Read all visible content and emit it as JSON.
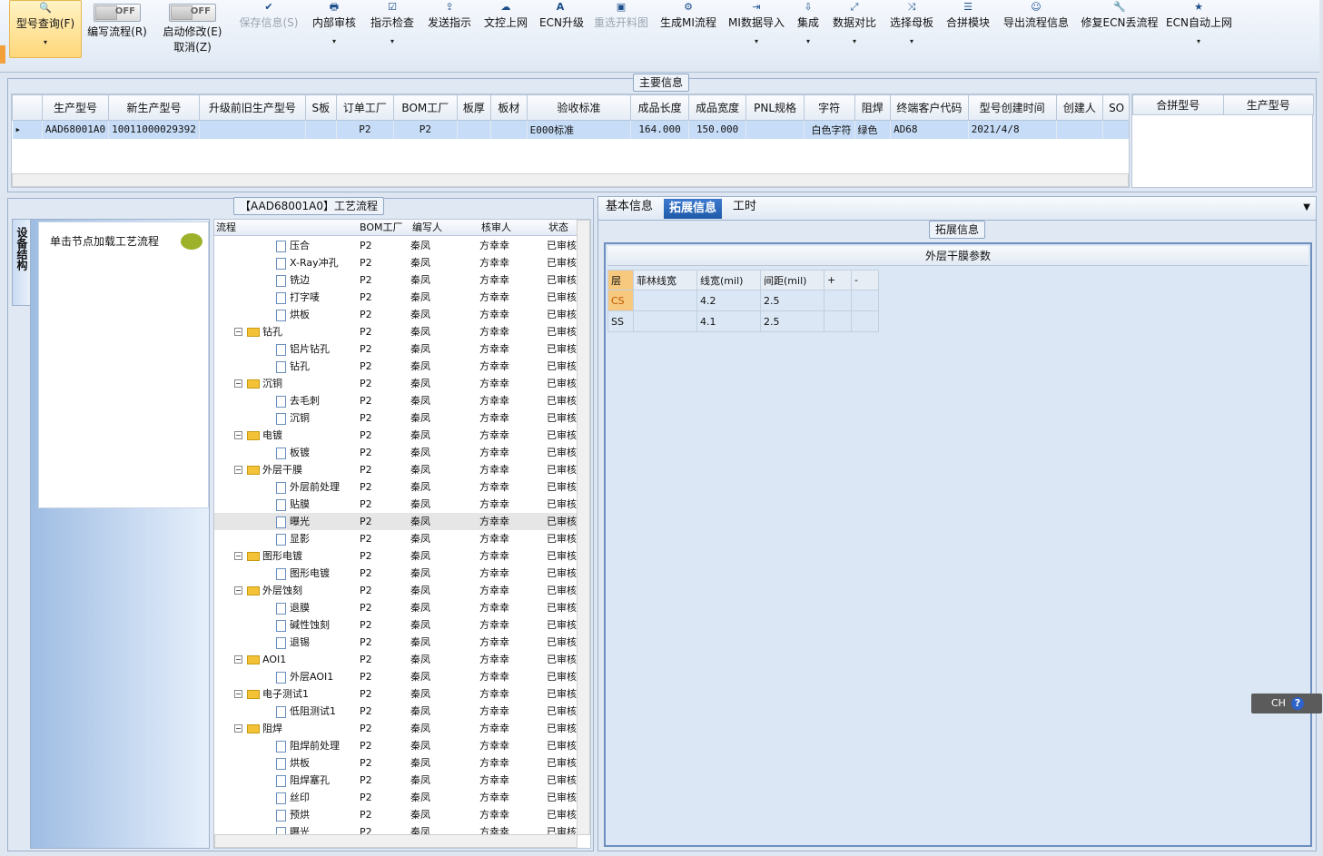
{
  "toolbar": {
    "items": [
      {
        "label": "型号查询(F)",
        "icon": "search-icon",
        "state": "active"
      },
      {
        "label": "编写流程(R)",
        "toggle": "OFF"
      },
      {
        "label": "启动修改(E)",
        "label2": "取消(Z)",
        "toggle": "OFF"
      },
      {
        "label": "保存信息(S)",
        "icon": "check-icon",
        "state": "disabled"
      },
      {
        "label": "内部审核",
        "icon": "printer-icon"
      },
      {
        "label": "指示检查",
        "icon": "checkbox-icon"
      },
      {
        "label": "发送指示",
        "icon": "upload-icon"
      },
      {
        "label": "文控上网",
        "icon": "cloud-upload-icon"
      },
      {
        "label": "ECN升级",
        "icon": "letter-a-icon"
      },
      {
        "label": "重选开料图",
        "icon": "image-icon",
        "state": "disabled"
      },
      {
        "label": "生成MI流程",
        "icon": "gears-icon"
      },
      {
        "label": "MI数据导入",
        "icon": "import-icon"
      },
      {
        "label": "集成",
        "icon": "download-icon"
      },
      {
        "label": "数据对比",
        "icon": "compare-icon"
      },
      {
        "label": "选择母板",
        "icon": "shuffle-icon"
      },
      {
        "label": "合拼模块",
        "icon": "list-icon"
      },
      {
        "label": "导出流程信息",
        "icon": "smiley-icon"
      },
      {
        "label": "修复ECN丢流程",
        "icon": "wrench-icon"
      },
      {
        "label": "ECN自动上网",
        "icon": "star-icon"
      }
    ]
  },
  "main_info": {
    "caption": "主要信息",
    "columns": [
      "生产型号",
      "新生产型号",
      "升级前旧生产型号",
      "S板",
      "订单工厂",
      "BOM工厂",
      "板厚",
      "板材",
      "验收标准",
      "成品长度",
      "成品宽度",
      "PNL规格",
      "字符",
      "阻焊",
      "终端客户代码",
      "型号创建时间",
      "创建人",
      "SO"
    ],
    "row": [
      "AAD68001A0",
      "10011000029392",
      "",
      "",
      "P2",
      "P2",
      "",
      "",
      "E000标准",
      "164.000",
      "150.000",
      "",
      "白色字符",
      "绿色",
      "AD68",
      "2021/4/8",
      "",
      ""
    ],
    "side_columns": [
      "合拼型号",
      "生产型号"
    ]
  },
  "process": {
    "caption": "【AAD68001A0】工艺流程",
    "side_tab": "设备结构",
    "hint": "单击节点加载工艺流程",
    "columns": [
      "流程",
      "BOM工厂",
      "编写人",
      "核审人",
      "状态"
    ],
    "rows": [
      {
        "name": "压合",
        "lvl": 2
      },
      {
        "name": "X-Ray冲孔",
        "lvl": 2
      },
      {
        "name": "铣边",
        "lvl": 2
      },
      {
        "name": "打字唛",
        "lvl": 2
      },
      {
        "name": "烘板",
        "lvl": 2
      },
      {
        "name": "钻孔",
        "lvl": 1
      },
      {
        "name": "铝片钻孔",
        "lvl": 2
      },
      {
        "name": "钻孔",
        "lvl": 2
      },
      {
        "name": "沉铜",
        "lvl": 1
      },
      {
        "name": "去毛刺",
        "lvl": 2
      },
      {
        "name": "沉铜",
        "lvl": 2
      },
      {
        "name": "电镀",
        "lvl": 1
      },
      {
        "name": "板镀",
        "lvl": 2
      },
      {
        "name": "外层干膜",
        "lvl": 1
      },
      {
        "name": "外层前处理",
        "lvl": 2
      },
      {
        "name": "贴膜",
        "lvl": 2
      },
      {
        "name": "曝光",
        "lvl": 2,
        "sel": true
      },
      {
        "name": "显影",
        "lvl": 2
      },
      {
        "name": "图形电镀",
        "lvl": 1
      },
      {
        "name": "图形电镀",
        "lvl": 2
      },
      {
        "name": "外层蚀刻",
        "lvl": 1
      },
      {
        "name": "退膜",
        "lvl": 2
      },
      {
        "name": "碱性蚀刻",
        "lvl": 2
      },
      {
        "name": "退锡",
        "lvl": 2
      },
      {
        "name": "AOI1",
        "lvl": 1
      },
      {
        "name": "外层AOI1",
        "lvl": 2
      },
      {
        "name": "电子测试1",
        "lvl": 1
      },
      {
        "name": "低阻测试1",
        "lvl": 2
      },
      {
        "name": "阻焊",
        "lvl": 1
      },
      {
        "name": "阻焊前处理",
        "lvl": 2
      },
      {
        "name": "烘板",
        "lvl": 2
      },
      {
        "name": "阻焊塞孔",
        "lvl": 2
      },
      {
        "name": "丝印",
        "lvl": 2
      },
      {
        "name": "预烘",
        "lvl": 2
      },
      {
        "name": "曝光",
        "lvl": 2
      }
    ],
    "factory": "P2",
    "writer": "秦凤",
    "reviewer": "方幸幸",
    "status": "已审核"
  },
  "detail": {
    "tabs": [
      "基本信息",
      "拓展信息",
      "工时"
    ],
    "active_tab": "拓展信息",
    "caption": "拓展信息",
    "table_title": "外层干膜参数",
    "columns": [
      "层",
      "菲林线宽",
      "线宽(mil)",
      "间距(mil)",
      "+",
      "-"
    ],
    "rows": [
      [
        "CS",
        "",
        "4.2",
        "2.5",
        "",
        ""
      ],
      [
        "SS",
        "",
        "4.1",
        "2.5",
        "",
        ""
      ]
    ]
  },
  "ime": {
    "label": "CH",
    "help": "?"
  }
}
